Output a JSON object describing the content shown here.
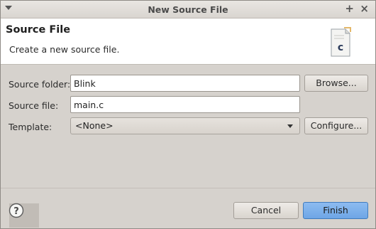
{
  "window": {
    "title": "New Source File"
  },
  "header": {
    "title": "Source File",
    "description": "Create a new source file.",
    "icon_glyph": "c"
  },
  "form": {
    "source_folder": {
      "label": "Source folder:",
      "value": "Blink"
    },
    "source_file": {
      "label": "Source file:",
      "value": "main.c"
    },
    "template": {
      "label": "Template:",
      "selected": "<None>"
    }
  },
  "buttons": {
    "browse": "Browse...",
    "configure": "Configure...",
    "cancel": "Cancel",
    "finish": "Finish"
  },
  "icons": {
    "window_menu": "chevron-down-icon",
    "maximize": "plus-icon",
    "close": "close-icon",
    "file": "c-source-file-icon",
    "help": "help-icon"
  },
  "colors": {
    "finish_button": "#7aaee9",
    "header_background": "#ffffff",
    "dialog_background": "#d6d2cd"
  }
}
